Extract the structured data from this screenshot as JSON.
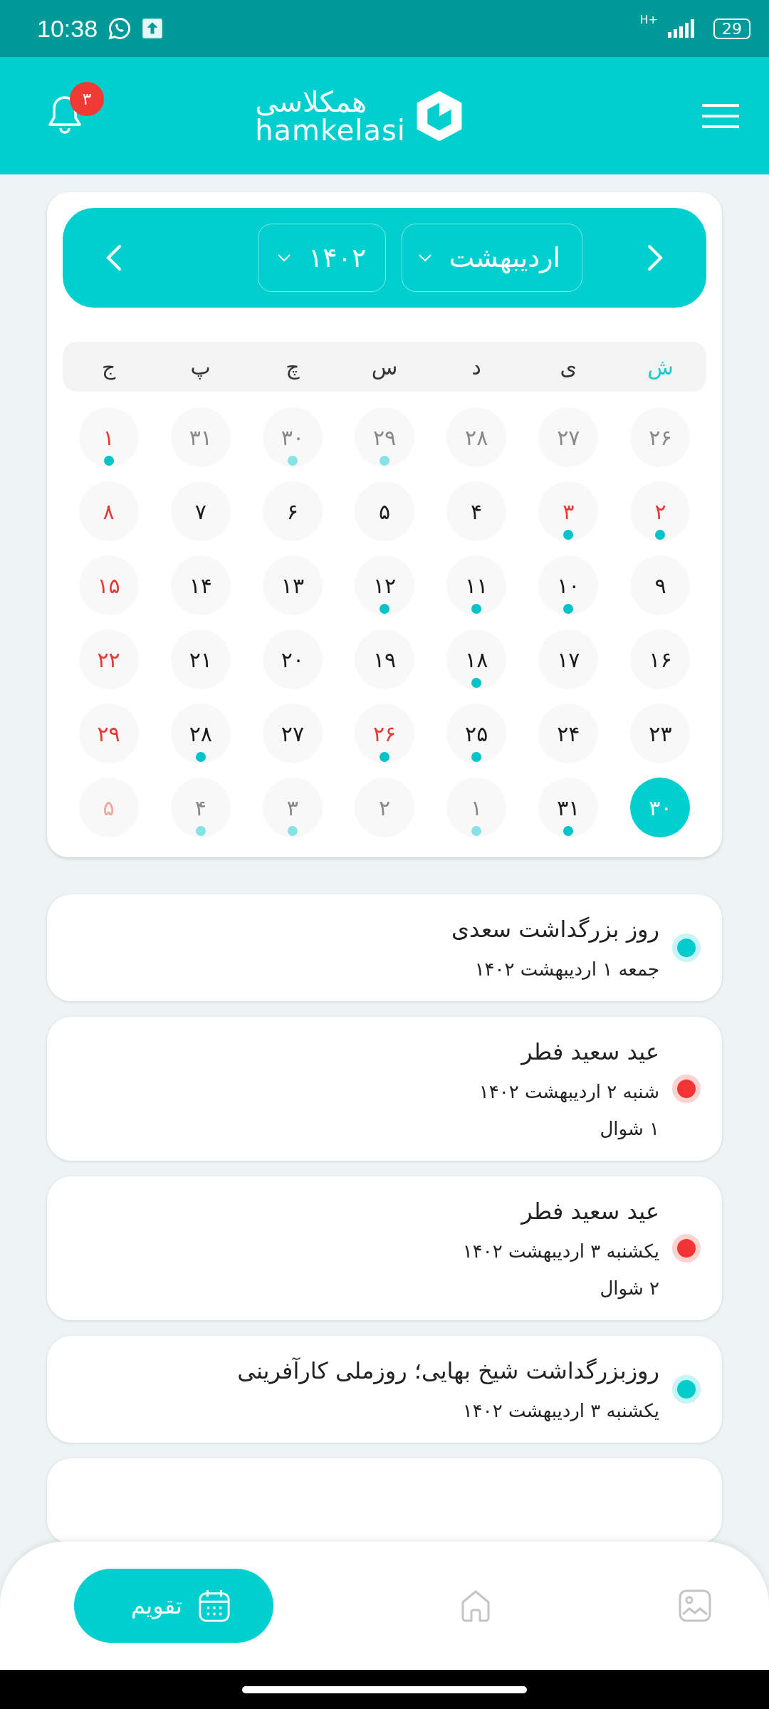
{
  "status_bar": {
    "time": "10:38",
    "network": "H+",
    "battery": "29"
  },
  "header": {
    "logo_fa": "همکلاسی",
    "logo_en": "hamkelasi",
    "notification_count": "۳"
  },
  "calendar": {
    "month": "اردیبهشت",
    "year": "۱۴۰۲",
    "weekdays": [
      {
        "label": "ش",
        "selected": true
      },
      {
        "label": "ی",
        "selected": false
      },
      {
        "label": "د",
        "selected": false
      },
      {
        "label": "س",
        "selected": false
      },
      {
        "label": "چ",
        "selected": false
      },
      {
        "label": "پ",
        "selected": false
      },
      {
        "label": "ج",
        "selected": false
      }
    ],
    "days": [
      {
        "label": "۲۶",
        "outside": true,
        "holiday": false,
        "event": false,
        "selected": false
      },
      {
        "label": "۲۷",
        "outside": true,
        "holiday": false,
        "event": false,
        "selected": false
      },
      {
        "label": "۲۸",
        "outside": true,
        "holiday": false,
        "event": false,
        "selected": false
      },
      {
        "label": "۲۹",
        "outside": true,
        "holiday": false,
        "event": true,
        "selected": false
      },
      {
        "label": "۳۰",
        "outside": true,
        "holiday": false,
        "event": true,
        "selected": false
      },
      {
        "label": "۳۱",
        "outside": true,
        "holiday": false,
        "event": false,
        "selected": false
      },
      {
        "label": "۱",
        "outside": false,
        "holiday": true,
        "event": true,
        "selected": false
      },
      {
        "label": "۲",
        "outside": false,
        "holiday": true,
        "event": true,
        "selected": false
      },
      {
        "label": "۳",
        "outside": false,
        "holiday": true,
        "event": true,
        "selected": false
      },
      {
        "label": "۴",
        "outside": false,
        "holiday": false,
        "event": false,
        "selected": false
      },
      {
        "label": "۵",
        "outside": false,
        "holiday": false,
        "event": false,
        "selected": false
      },
      {
        "label": "۶",
        "outside": false,
        "holiday": false,
        "event": false,
        "selected": false
      },
      {
        "label": "۷",
        "outside": false,
        "holiday": false,
        "event": false,
        "selected": false
      },
      {
        "label": "۸",
        "outside": false,
        "holiday": true,
        "event": false,
        "selected": false
      },
      {
        "label": "۹",
        "outside": false,
        "holiday": false,
        "event": false,
        "selected": false
      },
      {
        "label": "۱۰",
        "outside": false,
        "holiday": false,
        "event": true,
        "selected": false
      },
      {
        "label": "۱۱",
        "outside": false,
        "holiday": false,
        "event": true,
        "selected": false
      },
      {
        "label": "۱۲",
        "outside": false,
        "holiday": false,
        "event": true,
        "selected": false
      },
      {
        "label": "۱۳",
        "outside": false,
        "holiday": false,
        "event": false,
        "selected": false
      },
      {
        "label": "۱۴",
        "outside": false,
        "holiday": false,
        "event": false,
        "selected": false
      },
      {
        "label": "۱۵",
        "outside": false,
        "holiday": true,
        "event": false,
        "selected": false
      },
      {
        "label": "۱۶",
        "outside": false,
        "holiday": false,
        "event": false,
        "selected": false
      },
      {
        "label": "۱۷",
        "outside": false,
        "holiday": false,
        "event": false,
        "selected": false
      },
      {
        "label": "۱۸",
        "outside": false,
        "holiday": false,
        "event": true,
        "selected": false
      },
      {
        "label": "۱۹",
        "outside": false,
        "holiday": false,
        "event": false,
        "selected": false
      },
      {
        "label": "۲۰",
        "outside": false,
        "holiday": false,
        "event": false,
        "selected": false
      },
      {
        "label": "۲۱",
        "outside": false,
        "holiday": false,
        "event": false,
        "selected": false
      },
      {
        "label": "۲۲",
        "outside": false,
        "holiday": true,
        "event": false,
        "selected": false
      },
      {
        "label": "۲۳",
        "outside": false,
        "holiday": false,
        "event": false,
        "selected": false
      },
      {
        "label": "۲۴",
        "outside": false,
        "holiday": false,
        "event": false,
        "selected": false
      },
      {
        "label": "۲۵",
        "outside": false,
        "holiday": false,
        "event": true,
        "selected": false
      },
      {
        "label": "۲۶",
        "outside": false,
        "holiday": true,
        "event": true,
        "selected": false
      },
      {
        "label": "۲۷",
        "outside": false,
        "holiday": false,
        "event": false,
        "selected": false
      },
      {
        "label": "۲۸",
        "outside": false,
        "holiday": false,
        "event": true,
        "selected": false
      },
      {
        "label": "۲۹",
        "outside": false,
        "holiday": true,
        "event": false,
        "selected": false
      },
      {
        "label": "۳۰",
        "outside": false,
        "holiday": false,
        "event": false,
        "selected": true
      },
      {
        "label": "۳۱",
        "outside": false,
        "holiday": false,
        "event": true,
        "selected": false
      },
      {
        "label": "۱",
        "outside": true,
        "holiday": false,
        "event": true,
        "selected": false
      },
      {
        "label": "۲",
        "outside": true,
        "holiday": false,
        "event": false,
        "selected": false
      },
      {
        "label": "۳",
        "outside": true,
        "holiday": false,
        "event": true,
        "selected": false
      },
      {
        "label": "۴",
        "outside": true,
        "holiday": false,
        "event": true,
        "selected": false
      },
      {
        "label": "۵",
        "outside": true,
        "holiday": true,
        "event": false,
        "selected": false
      }
    ]
  },
  "events": [
    {
      "title": "روز بزرگداشت سعدی",
      "date": "جمعه ۱ اردیبهشت ۱۴۰۲",
      "color": "#00cccc"
    },
    {
      "title": "عید سعید فطر",
      "date": "شنبه ۲ اردیبهشت ۱۴۰۲",
      "hijri": "۱ شوال",
      "color": "#f23434"
    },
    {
      "title": "عید سعید فطر",
      "date": "یکشنبه ۳ اردیبهشت ۱۴۰۲",
      "hijri": "۲ شوال",
      "color": "#f23434"
    },
    {
      "title": "روزبزرگداشت شیخ بهایی؛ روزملی کارآفرینی",
      "date": "یکشنبه ۳ اردیبهشت ۱۴۰۲",
      "color": "#00cccc"
    }
  ],
  "bottom_nav": [
    {
      "kind": "gallery",
      "selected": false
    },
    {
      "kind": "home",
      "selected": false
    },
    {
      "kind": "calendar",
      "label": "تقویم",
      "selected": true
    }
  ]
}
